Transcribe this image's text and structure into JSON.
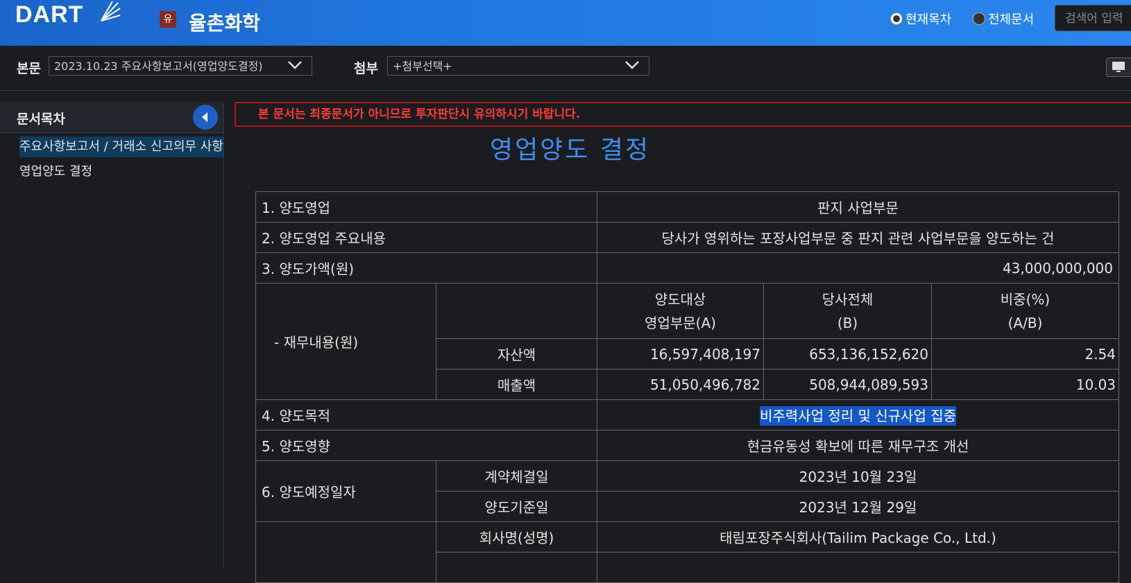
{
  "header": {
    "logo_text": "DART",
    "corp_badge": "유",
    "corp_name": "율촌화학",
    "radio_current": "현재목차",
    "radio_all": "전체문서",
    "search_placeholder": "검색어 입력"
  },
  "toolbar": {
    "main_label": "본문",
    "main_select": "2023.10.23  주요사항보고서(영업양도결정)",
    "attach_label": "첨부",
    "attach_select": "+첨부선택+"
  },
  "sidebar": {
    "title": "문서목차",
    "items": [
      {
        "label": "주요사항보고서 / 거래소 신고의무 사항"
      },
      {
        "label": "영업양도 결정"
      }
    ]
  },
  "main": {
    "warning": "본 문서는 최종문서가 아니므로 투자판단시 유의하시기 바랍니다.",
    "title": "영업양도 결정"
  },
  "table": {
    "r1_label": "1. 양도영업",
    "r1_value": "판지 사업부문",
    "r2_label": "2. 양도영업 주요내용",
    "r2_value": "당사가 영위하는 포장사업부문 중 판지 관련 사업부문을 양도하는 건",
    "r3_label": "3. 양도가액(원)",
    "r3_value": "43,000,000,000",
    "fin_label": "- 재무내용(원)",
    "fin_h1a": "양도대상",
    "fin_h1b": "영업부문(A)",
    "fin_h2a": "당사전체",
    "fin_h2b": "(B)",
    "fin_h3a": "비중(%)",
    "fin_h3b": "(A/B)",
    "asset_label": "자산액",
    "asset_a": "16,597,408,197",
    "asset_b": "653,136,152,620",
    "asset_ratio": "2.54",
    "sales_label": "매출액",
    "sales_a": "51,050,496,782",
    "sales_b": "508,944,089,593",
    "sales_ratio": "10.03",
    "r4_label": "4. 양도목적",
    "r4_value": "비주력사업 정리 및 신규사업 집중",
    "r5_label": "5. 양도영향",
    "r5_value": "현금유동성 확보에 따른 재무구조 개선",
    "r6_label": "6. 양도예정일자",
    "r6a_label": "계약체결일",
    "r6a_value": "2023년 10월 23일",
    "r6b_label": "양도기준일",
    "r6b_value": "2023년 12월 29일",
    "r7a_label": "회사명(성명)",
    "r7a_value": "태림포장주식회사(Tailim Package Co., Ltd.)"
  }
}
